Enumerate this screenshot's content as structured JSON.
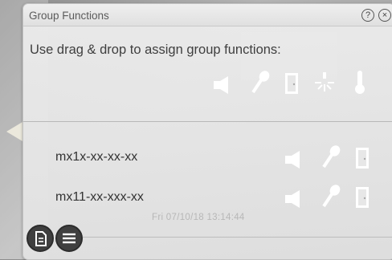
{
  "window": {
    "title": "Group Functions",
    "help_icon": "help-icon",
    "close_icon": "close-icon"
  },
  "instruction": "Use drag & drop to assign group functions:",
  "group_functions": [
    {
      "name": "speaker-icon"
    },
    {
      "name": "microphone-icon"
    },
    {
      "name": "door-icon"
    },
    {
      "name": "light-icon"
    },
    {
      "name": "thermometer-icon"
    }
  ],
  "devices": [
    {
      "label": "mx1x-xx-xx-xx",
      "icons": [
        "speaker-icon",
        "microphone-icon",
        "door-icon"
      ]
    },
    {
      "label": "mx11-xx-xxx-xx",
      "icons": [
        "speaker-icon",
        "microphone-icon",
        "door-icon"
      ]
    }
  ],
  "status": {
    "timestamp": "Fri 07/10/18 13:14:44"
  },
  "footer": {
    "buttons": [
      "document-icon",
      "menu-icon"
    ]
  },
  "colors": {
    "icon": "#ffffff",
    "text": "#333333",
    "pointer": "#ebe8dc"
  }
}
